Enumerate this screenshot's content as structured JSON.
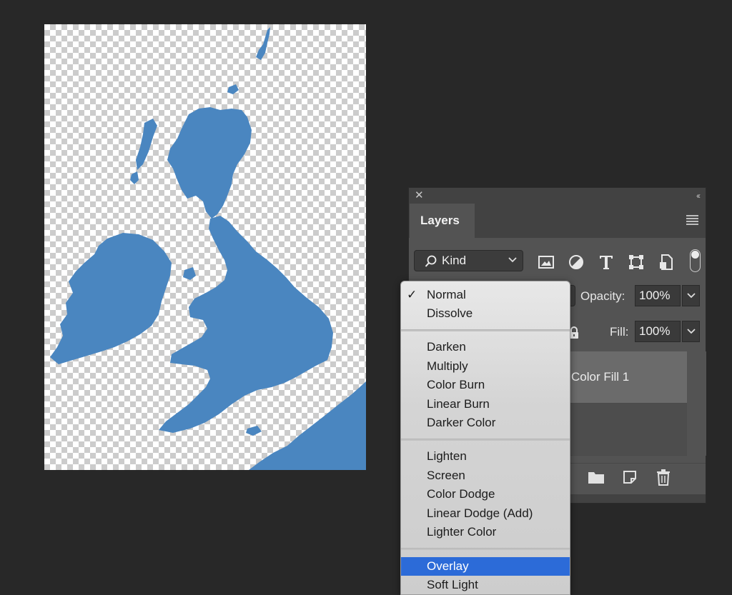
{
  "layers_panel": {
    "tab_label": "Layers",
    "kind_label": "Kind",
    "opacity_label": "Opacity:",
    "opacity_value": "100%",
    "fill_label": "Fill:",
    "fill_value": "100%",
    "layers": [
      {
        "name": "Color Fill 1"
      }
    ]
  },
  "blend_menu": {
    "checkmark": "✓",
    "groups": [
      [
        "Normal",
        "Dissolve"
      ],
      [
        "Darken",
        "Multiply",
        "Color Burn",
        "Linear Burn",
        "Darker Color"
      ],
      [
        "Lighten",
        "Screen",
        "Color Dodge",
        "Linear Dodge (Add)",
        "Lighter Color"
      ],
      [
        "Overlay",
        "Soft Light"
      ]
    ],
    "checked_item": "Normal",
    "highlighted_item": "Overlay"
  },
  "colors": {
    "map_fill": "#4a86c0",
    "workspace": "#282828",
    "menu_highlight": "#2c6bd8"
  }
}
